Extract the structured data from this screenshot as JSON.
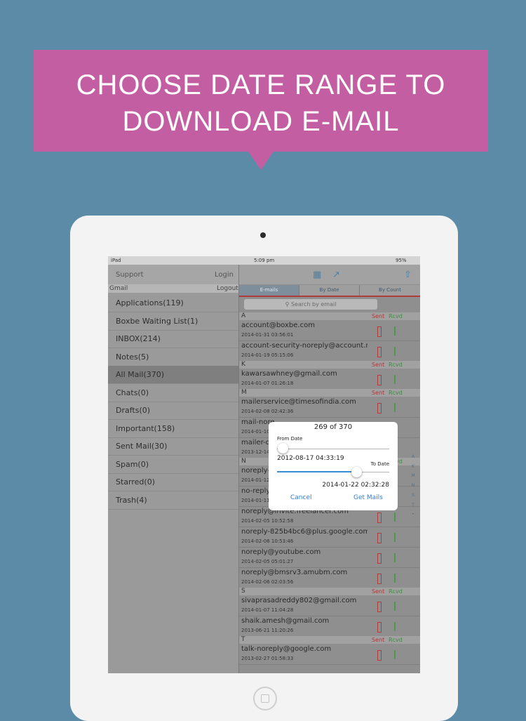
{
  "banner": {
    "line1": "CHOOSE DATE RANGE TO",
    "line2": "DOWNLOAD E-MAIL"
  },
  "status_bar": {
    "device": "iPad",
    "time": "5:09 pm",
    "battery": "95%"
  },
  "sidebar": {
    "support": "Support",
    "login": "Login",
    "account": "Gmail",
    "logout": "Logout",
    "folders": [
      "Applications(119)",
      "Boxbe Waiting List(1)",
      "INBOX(214)",
      "Notes(5)",
      "All Mail(370)",
      "Chats(0)",
      "Drafts(0)",
      "Important(158)",
      "Sent Mail(30)",
      "Spam(0)",
      "Starred(0)",
      "Trash(4)"
    ],
    "selected_index": 4
  },
  "toolbar": {
    "icons": [
      "calendar-icon",
      "chart-icon",
      "share-icon"
    ]
  },
  "segments": [
    "E-mails",
    "By Date",
    "By Count"
  ],
  "search": {
    "placeholder": "Search by email"
  },
  "columns": {
    "sent": "Sent",
    "received": "Rcvd"
  },
  "sections": [
    {
      "letter": "A",
      "mails": [
        {
          "addr": "account@boxbe.com",
          "date": "2014-01-31 03:56:01"
        },
        {
          "addr": "account-security-noreply@account.mic...",
          "date": "2014-01-19 05:15:06"
        }
      ]
    },
    {
      "letter": "K",
      "mails": [
        {
          "addr": "kawarsawhney@gmail.com",
          "date": "2014-01-07 01:26:18"
        }
      ]
    },
    {
      "letter": "M",
      "mails": [
        {
          "addr": "mailerservice@timesofindia.com",
          "date": "2014-02-08 02:42:36"
        },
        {
          "addr": "mail-nore",
          "date": "2014-01-10"
        },
        {
          "addr": "mailer-da",
          "date": "2013-12-14"
        }
      ]
    },
    {
      "letter": "N",
      "mails": [
        {
          "addr": "noreply-p",
          "date": "2014-01-12"
        },
        {
          "addr": "no-reply",
          "date": "2014-01-11"
        },
        {
          "addr": "noreply@invite.freelancer.com",
          "date": "2014-02-05 10:52:58"
        },
        {
          "addr": "noreply-825b4bc6@plus.google.com",
          "date": "2014-02-06 10:53:46"
        },
        {
          "addr": "noreply@youtube.com",
          "date": "2014-02-05 05:01:27"
        },
        {
          "addr": "noreply@bmsrv3.amubm.com",
          "date": "2014-02-06 02:03:56"
        }
      ]
    },
    {
      "letter": "S",
      "mails": [
        {
          "addr": "sivaprasadreddy802@gmail.com",
          "date": "2014-01-07 11:04:28"
        },
        {
          "addr": "shaik.amesh@gmail.com",
          "date": "2013-06-21 11:20:26"
        }
      ]
    },
    {
      "letter": "T",
      "mails": [
        {
          "addr": "talk-noreply@google.com",
          "date": "2013-02-27 01:58:33"
        }
      ]
    }
  ],
  "index_letters": [
    "A",
    "K",
    "M",
    "N",
    "S",
    "T",
    "•"
  ],
  "dialog": {
    "count": "269 of 370",
    "from_label": "From Date",
    "from_value": "2012-08-17 04:33:19",
    "from_slider_fraction": 0.0,
    "to_label": "To Date",
    "to_value": "2014-01-22 02:32:28",
    "to_slider_fraction": 0.7,
    "cancel": "Cancel",
    "confirm": "Get Mails"
  }
}
